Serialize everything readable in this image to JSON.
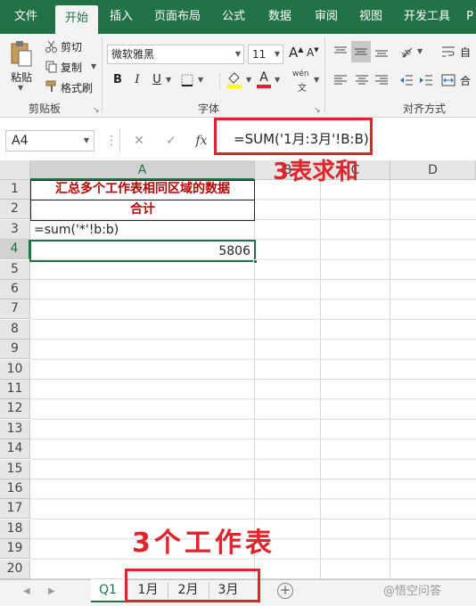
{
  "ribbon_tabs": [
    "文件",
    "开始",
    "插入",
    "页面布局",
    "公式",
    "数据",
    "审阅",
    "视图",
    "开发工具",
    "P"
  ],
  "active_tab": "开始",
  "clipboard": {
    "paste": "粘贴",
    "cut": "剪切",
    "copy": "复制",
    "format_painter": "格式刷",
    "group_label": "剪贴板"
  },
  "font": {
    "name": "微软雅黑",
    "size": "11",
    "bold": "B",
    "italic": "I",
    "underline": "U",
    "font_color_glyph": "A",
    "phonetic": "wén",
    "group_label": "字体"
  },
  "alignment": {
    "group_label": "对齐方式",
    "auto_label": "自",
    "merge_label": "合"
  },
  "formula_bar": {
    "name_box": "A4",
    "cancel": "✕",
    "enter": "✓",
    "fx": "fx",
    "formula": "=SUM('1月:3月'!B:B)"
  },
  "columns": [
    "A",
    "B",
    "C",
    "D"
  ],
  "rows": [
    "1",
    "2",
    "3",
    "4",
    "5",
    "6",
    "7",
    "8",
    "9",
    "10",
    "11",
    "12",
    "13",
    "14",
    "15",
    "16",
    "17",
    "18",
    "19",
    "20"
  ],
  "cells": {
    "a1": "汇总多个工作表相同区域的数据",
    "a2": "合计",
    "a3": "=sum('*'!b:b)",
    "a4": "5806"
  },
  "annotations": {
    "top": "3表求和",
    "bottom": "3个工作表"
  },
  "sheet_tabs": [
    "Q1",
    "1月",
    "2月",
    "3月"
  ],
  "active_sheet": "Q1",
  "watermark": "@悟空问答",
  "colors": {
    "excel_green": "#217346",
    "annotation_red": "#e0242b",
    "cell_red": "#c00000"
  }
}
